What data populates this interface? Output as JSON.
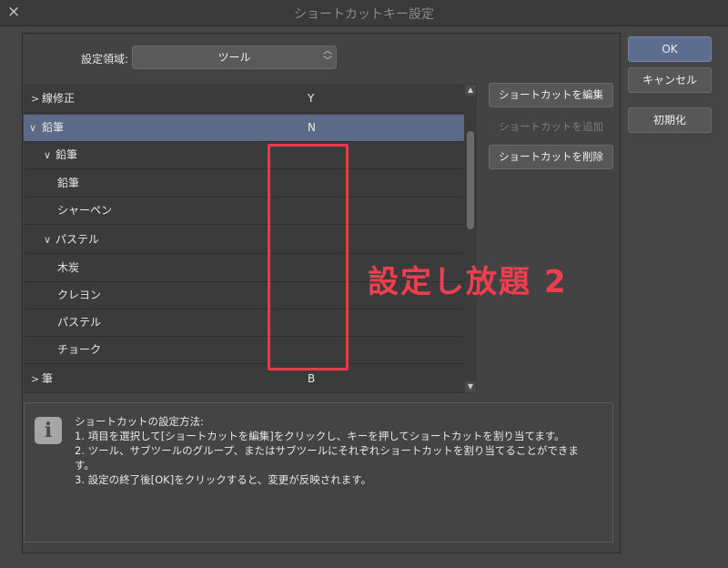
{
  "dialog": {
    "title": "ショートカットキー設定",
    "close_icon": "×"
  },
  "area": {
    "label": "設定領域:",
    "selected": "ツール",
    "arrows_up": "︿",
    "arrows_down": "﹀"
  },
  "tree": {
    "rows": [
      {
        "label": "線修正",
        "key": "Y",
        "chevron": ">",
        "selected": false
      },
      {
        "label": "鉛筆",
        "key": "N",
        "chevron": "∨",
        "selected": true
      },
      {
        "label": "鉛筆",
        "key": "",
        "chevron": "∨",
        "selected": false
      },
      {
        "label": "鉛筆",
        "key": "",
        "chevron": "",
        "selected": false
      },
      {
        "label": "シャーペン",
        "key": "",
        "chevron": "",
        "selected": false
      },
      {
        "label": "パステル",
        "key": "",
        "chevron": "∨",
        "selected": false
      },
      {
        "label": "木炭",
        "key": "",
        "chevron": "",
        "selected": false
      },
      {
        "label": "クレヨン",
        "key": "",
        "chevron": "",
        "selected": false
      },
      {
        "label": "パステル",
        "key": "",
        "chevron": "",
        "selected": false
      },
      {
        "label": "チョーク",
        "key": "",
        "chevron": "",
        "selected": false
      },
      {
        "label": "筆",
        "key": "B",
        "chevron": ">",
        "selected": false
      }
    ]
  },
  "side_buttons": {
    "edit": "ショートカットを編集",
    "add": "ショートカットを追加",
    "delete": "ショートカットを削除"
  },
  "dialog_buttons": {
    "ok": "OK",
    "cancel": "キャンセル",
    "reset": "初期化"
  },
  "info": {
    "icon": "i",
    "heading": "ショートカットの設定方法:",
    "line1": "1. 項目を選択して[ショートカットを編集]をクリックし、キーを押してショートカットを割り当てます。",
    "line2": "2. ツール、サブツールのグループ、またはサブツールにそれぞれショートカットを割り当てることができま",
    "line2b": "す。",
    "line3": "3. 設定の終了後[OK]をクリックすると、変更が反映されます。"
  },
  "annotation": {
    "text": "設定し放題 2",
    "color": "#ee3f4f"
  },
  "colors": {
    "selected_row": "#5b6b87",
    "primary_button": "#5d6d90",
    "background": "#454545"
  }
}
